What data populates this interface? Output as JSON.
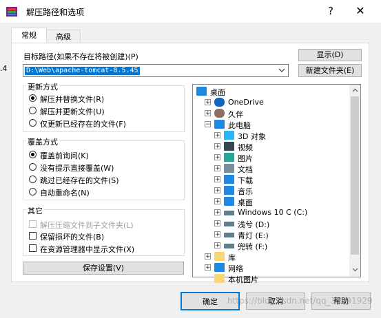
{
  "window": {
    "title": "解压路径和选项",
    "help_glyph": "?",
    "close_glyph": "✕",
    "left_fragment": ".4"
  },
  "tabs": [
    {
      "label": "常规"
    },
    {
      "label": "高级"
    }
  ],
  "destination": {
    "label": "目标路径(如果不存在将被创建)(P)",
    "value": "D:\\Web\\apache-tomcat-8.5.45",
    "show_button": "显示(D)",
    "new_folder_button": "新建文件夹(E)"
  },
  "update_mode": {
    "title": "更新方式",
    "options": [
      "解压并替换文件(R)",
      "解压并更新文件(U)",
      "仅更新已经存在的文件(F)"
    ],
    "selected_index": 0
  },
  "overwrite_mode": {
    "title": "覆盖方式",
    "options": [
      "覆盖前询问(K)",
      "没有提示直接覆盖(W)",
      "跳过已经存在的文件(S)",
      "自动重命名(N)"
    ],
    "selected_index": 0
  },
  "misc": {
    "title": "其它",
    "options": [
      {
        "label": "解压压缩文件到子文件夹(L)",
        "checked": false,
        "disabled": true
      },
      {
        "label": "保留损坏的文件(B)",
        "checked": false,
        "disabled": false
      },
      {
        "label": "在资源管理器中显示文件(X)",
        "checked": false,
        "disabled": false
      }
    ]
  },
  "save_settings_button": "保存设置(V)",
  "tree": {
    "items": [
      {
        "label": "桌面",
        "icon": "desktop-icon",
        "expander": "",
        "indent": 0
      },
      {
        "label": "OneDrive",
        "icon": "cloud-icon",
        "expander": "+",
        "indent": 1
      },
      {
        "label": "久伴",
        "icon": "user-icon",
        "expander": "+",
        "indent": 1
      },
      {
        "label": "此电脑",
        "icon": "computer-icon",
        "expander": "−",
        "indent": 1
      },
      {
        "label": "3D 对象",
        "icon": "3d-objects-icon",
        "expander": "+",
        "indent": 2
      },
      {
        "label": "视频",
        "icon": "video-icon",
        "expander": "+",
        "indent": 2
      },
      {
        "label": "图片",
        "icon": "pictures-icon",
        "expander": "+",
        "indent": 2
      },
      {
        "label": "文档",
        "icon": "documents-icon",
        "expander": "+",
        "indent": 2
      },
      {
        "label": "下载",
        "icon": "download-icon",
        "expander": "+",
        "indent": 2
      },
      {
        "label": "音乐",
        "icon": "music-icon",
        "expander": "+",
        "indent": 2
      },
      {
        "label": "桌面",
        "icon": "desktop-icon",
        "expander": "+",
        "indent": 2
      },
      {
        "label": "Windows 10 C (C:)",
        "icon": "drive-icon",
        "expander": "+",
        "indent": 2
      },
      {
        "label": "浅兮 (D:)",
        "icon": "drive-icon",
        "expander": "+",
        "indent": 2
      },
      {
        "label": "青灯 (E:)",
        "icon": "drive-icon",
        "expander": "+",
        "indent": 2
      },
      {
        "label": "兜转 (F:)",
        "icon": "drive-icon",
        "expander": "+",
        "indent": 2
      },
      {
        "label": "库",
        "icon": "library-icon",
        "expander": "+",
        "indent": 1
      },
      {
        "label": "网络",
        "icon": "network-icon",
        "expander": "+",
        "indent": 1
      },
      {
        "label": "本机图片",
        "icon": "folder-icon",
        "expander": "",
        "indent": 1
      }
    ]
  },
  "footer": {
    "ok": "确定",
    "cancel": "取消",
    "help": "帮助"
  },
  "watermark": "https://blog.csdn.net/qq_39291929",
  "colors": {
    "selection": "#0078d7",
    "folder": "#f8d775",
    "accent_blue": "#1e88e5"
  }
}
